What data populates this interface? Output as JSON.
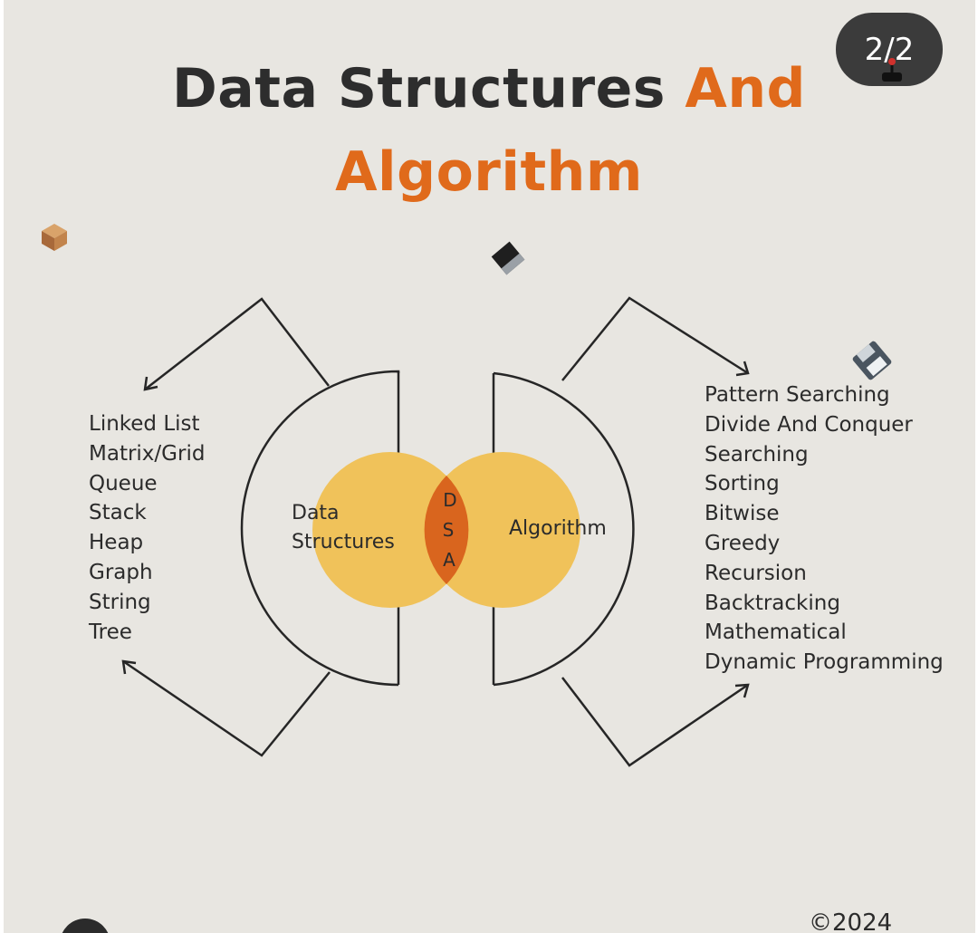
{
  "title": {
    "line1_dark": "Data Structures",
    "line1_accent": "And",
    "line2": "Algorithm"
  },
  "page_badge": "2/2",
  "diagram": {
    "left_label_line1": "Data",
    "left_label_line2": "Structures",
    "right_label": "Algorithm",
    "intersection_letters": [
      "D",
      "S",
      "A"
    ]
  },
  "data_structures": [
    "Linked List",
    "Matrix/Grid",
    "Queue",
    "Stack",
    "Heap",
    "Graph",
    "String",
    "Tree"
  ],
  "algorithms": [
    "Pattern Searching",
    "Divide And Conquer",
    "Searching",
    "Sorting",
    "Bitwise",
    "Greedy",
    "Recursion",
    "Backtracking",
    "Mathematical",
    "Dynamic Programming"
  ],
  "footer": {
    "copyright": "©2024"
  },
  "decorations": [
    "box-icon",
    "floppy-disk-icon",
    "pen-tablet-icon",
    "joystick-icon"
  ],
  "colors": {
    "background": "#e8e6e1",
    "accent_orange": "#e06a1b",
    "circle_yellow": "#f0c25a",
    "intersection_orange": "#d9651e",
    "text_dark": "#2d2d2d",
    "badge_dark": "#3b3b3b"
  }
}
